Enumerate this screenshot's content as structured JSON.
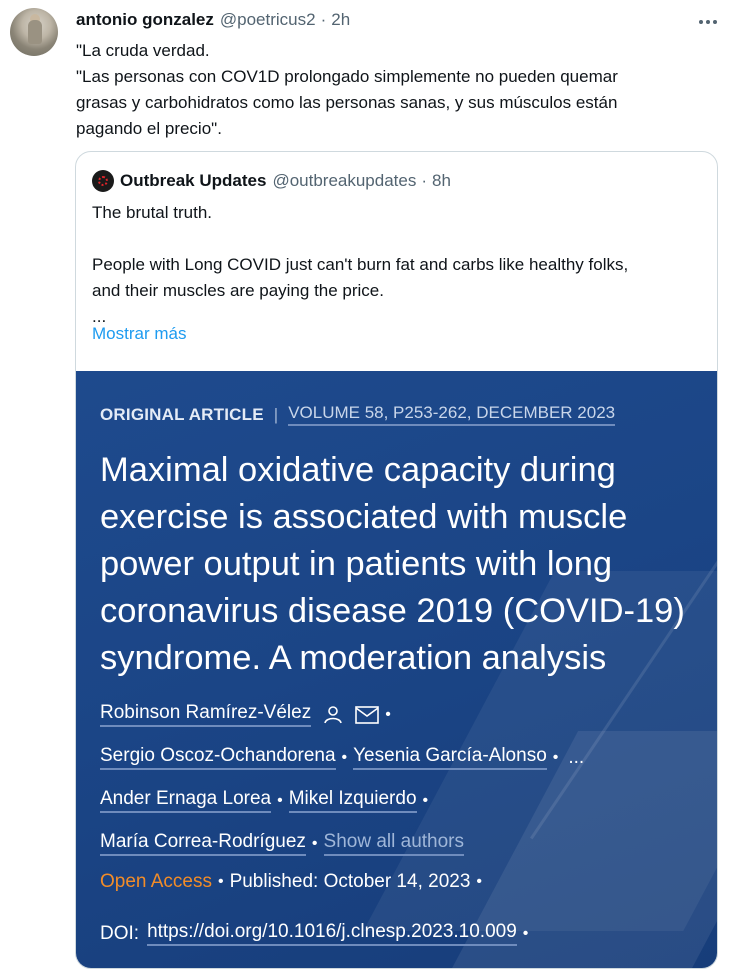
{
  "tweet": {
    "author_name": "antonio gonzalez",
    "handle": "@poetricus2",
    "separator": "·",
    "time": "2h",
    "text_lines": [
      "\"La cruda verdad.",
      "\"Las personas con COV1D prolongado simplemente no pueden quemar",
      "grasas y carbohidratos como las personas sanas, y sus músculos están",
      "pagando el precio\"."
    ],
    "more_icon": "more-horizontal-icon"
  },
  "quote": {
    "author_name": "Outbreak Updates",
    "handle": "@outbreakupdates",
    "separator": "·",
    "time": "8h",
    "line1": "The brutal truth.",
    "line2": "People with Long COVID just can't burn fat and carbs like healthy folks,",
    "line3": "and their muscles are paying the price.",
    "line4": "...",
    "show_more": "Mostrar más"
  },
  "article": {
    "kind": "ORIGINAL ARTICLE",
    "pipe": "|",
    "volume": "VOLUME 58, P253-262, DECEMBER 2023",
    "title": "Maximal oxidative capacity during exercise is associated with muscle power output in patients with long coronavirus disease 2019 (COVID-19) syndrome. A moderation analysis",
    "authors": {
      "a1": "Robinson Ramírez-Vélez",
      "a2": "Sergio Oscoz-Ochandorena",
      "a3": "Yesenia García-Alonso",
      "a4": "Ander Ernaga Lorea",
      "a5": "Mikel Izquierdo",
      "a6": "María Correa-Rodríguez",
      "show_all": "Show all authors",
      "ellipsis": "..."
    },
    "bullet": "•",
    "open_access": "Open Access",
    "published": "Published: October 14, 2023",
    "doi_label": "DOI:",
    "doi": "https://doi.org/10.1016/j.clnesp.2023.10.009"
  },
  "colors": {
    "accent_link": "#1d9bf0",
    "article_bg": "#1b4586",
    "open_access": "#f28c28"
  }
}
